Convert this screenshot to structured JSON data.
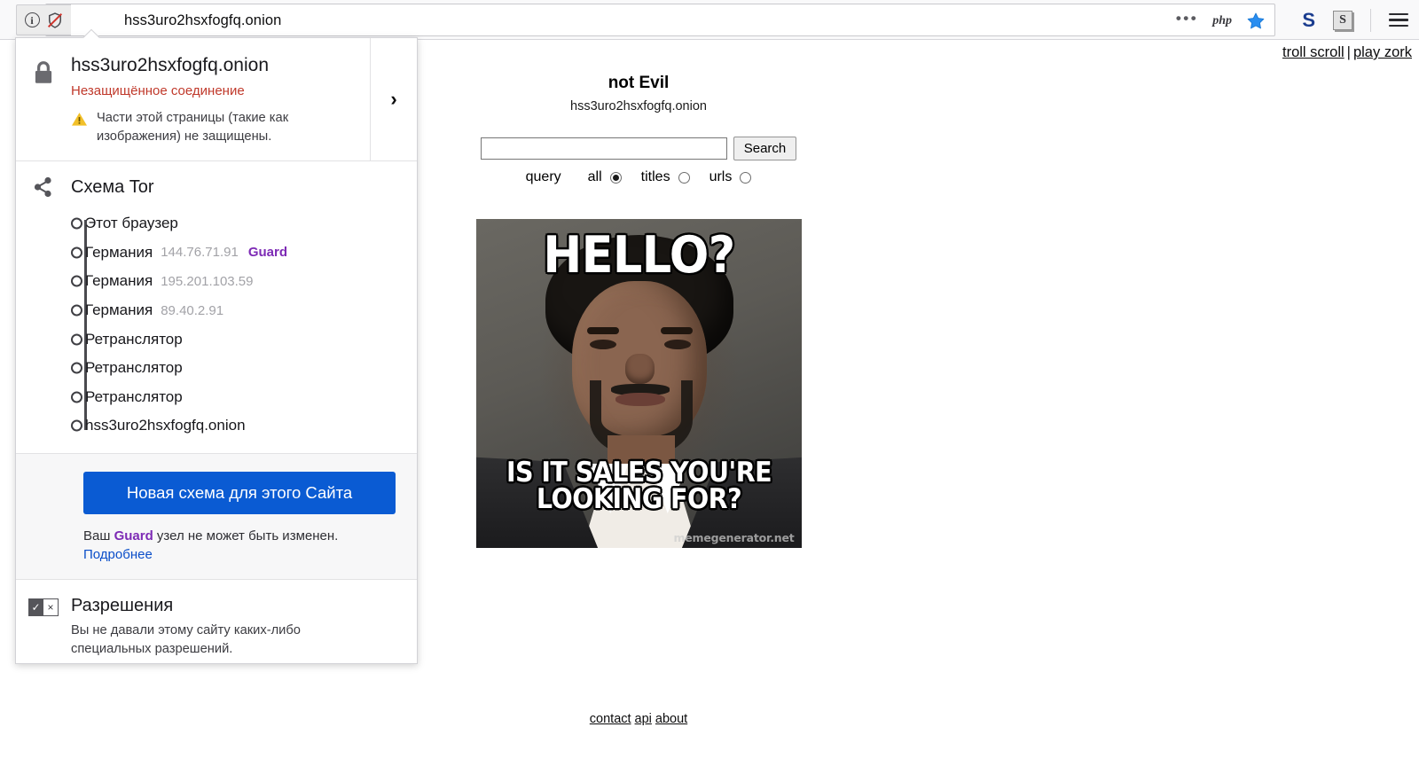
{
  "browser": {
    "url": "hss3uro2hsxfogfq.onion",
    "identity_icons": [
      "info-icon",
      "broken-shield-icon"
    ],
    "urlbar_icons": [
      "more-dots-icon",
      "php-icon",
      "bookmark-star-icon"
    ],
    "php_label": "php",
    "toolbar_icons": [
      "s-blue-icon",
      "s-gray-icon",
      "hamburger-menu-icon"
    ],
    "s_blue_label": "S",
    "s_gray_label": "S"
  },
  "panel": {
    "security": {
      "host": "hss3uro2hsxfogfq.onion",
      "status": "Незащищённое соединение",
      "warning": "Части этой страницы (такие как изображения) не защищены.",
      "expand_glyph": "›"
    },
    "tor": {
      "title": "Схема Tor",
      "nodes": [
        {
          "name": "Этот браузер",
          "ip": "",
          "tag": ""
        },
        {
          "name": "Германия",
          "ip": "144.76.71.91",
          "tag": "Guard"
        },
        {
          "name": "Германия",
          "ip": "195.201.103.59",
          "tag": ""
        },
        {
          "name": "Германия",
          "ip": "89.40.2.91",
          "tag": ""
        },
        {
          "name": "Ретранслятор",
          "ip": "",
          "tag": ""
        },
        {
          "name": "Ретранслятор",
          "ip": "",
          "tag": ""
        },
        {
          "name": "Ретранслятор",
          "ip": "",
          "tag": ""
        },
        {
          "name": "hss3uro2hsxfogfq.onion",
          "ip": "",
          "tag": ""
        }
      ]
    },
    "new_circuit": {
      "button_label": "Новая схема для этого Сайта",
      "note_prefix": "Ваш ",
      "note_guard": "Guard",
      "note_suffix": " узел не может быть изменен.",
      "learn_more": "Подробнее"
    },
    "permissions": {
      "title": "Разрешения",
      "text": "Вы не давали этому сайту каких-либо специальных разрешений.",
      "check_glyph": "✓",
      "cross_glyph": "×"
    }
  },
  "page": {
    "top_links": [
      {
        "label": "troll scroll"
      },
      {
        "label": "play zork"
      }
    ],
    "top_links_separator": "|",
    "site_title": "not Evil",
    "site_host": "hss3uro2hsxfogfq.onion",
    "search": {
      "value": "",
      "placeholder": "",
      "button_label": "Search",
      "scope_label": "query",
      "options": [
        {
          "label": "all",
          "checked": true
        },
        {
          "label": "titles",
          "checked": false
        },
        {
          "label": "urls",
          "checked": false
        }
      ]
    },
    "meme": {
      "top_text": "HELLO?",
      "bottom_text": "IS IT SALES YOU'RE LOOKING FOR?",
      "watermark": "memegenerator.net"
    },
    "footer_links": [
      {
        "label": "contact"
      },
      {
        "label": "api"
      },
      {
        "label": "about"
      }
    ]
  },
  "colors": {
    "accent_blue": "#0a5bd3",
    "guard_purple": "#7d2ab5",
    "insecure_red": "#c0392b",
    "warning_yellow": "#f2c029",
    "link_blue": "#0a4ec9"
  }
}
